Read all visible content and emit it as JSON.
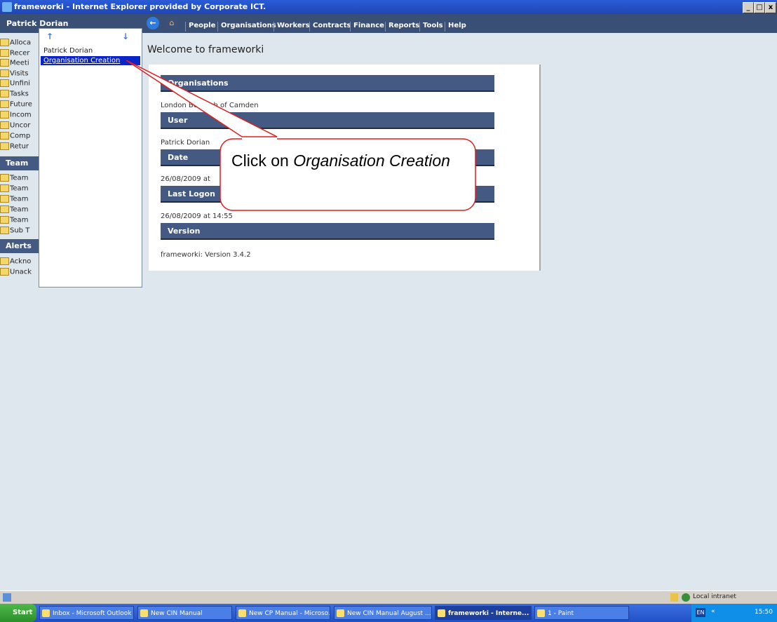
{
  "window": {
    "title": "frameworki - Internet Explorer provided by Corporate ICT.",
    "min": "_",
    "max": "□",
    "close": "x"
  },
  "user": {
    "name": "Patrick Dorian"
  },
  "nav": {
    "back_icon": "back-arrow-icon",
    "home_icon": "home-icon",
    "links": [
      "People",
      "Organisations",
      "Workers",
      "Contracts",
      "Finance",
      "Reports",
      "Tools",
      "Help"
    ]
  },
  "sidebar": {
    "items": [
      "Alloca",
      "Recer",
      "Meeti",
      "Visits",
      "Unfini",
      "Tasks",
      "Future",
      "Incom",
      "Uncor",
      "Comp",
      "Retur"
    ],
    "team_header": "Team",
    "team_items": [
      "Team",
      "Team",
      "Team",
      "Team",
      "Team",
      "Sub T"
    ],
    "alerts_header": "Alerts",
    "alert_items": [
      "Ackno",
      "Unack"
    ]
  },
  "dropdown": {
    "item1": "Patrick Dorian",
    "item2": "Organisation Creation"
  },
  "main": {
    "welcome": "Welcome to frameworki",
    "sections": [
      {
        "header": "Organisations",
        "value": "London Borough of Camden"
      },
      {
        "header": "User",
        "value": "Patrick Dorian"
      },
      {
        "header": "Date",
        "value": "26/08/2009 at"
      },
      {
        "header": "Last Logon",
        "value": "26/08/2009 at 14:55"
      },
      {
        "header": "Version",
        "value": "frameworki: Version 3.4.2"
      }
    ]
  },
  "callout": {
    "text_plain": "Click on ",
    "text_italic": "Organisation Creation"
  },
  "status": {
    "zone": "Local intranet"
  },
  "taskbar": {
    "start": "Start",
    "tasks": [
      "Inbox - Microsoft Outlook",
      "New CIN Manual",
      "New CP Manual - Microso...",
      "New CIN Manual August ...",
      "frameworki - Interne...",
      "1 - Paint"
    ],
    "lang": "EN",
    "time": "15:50"
  }
}
